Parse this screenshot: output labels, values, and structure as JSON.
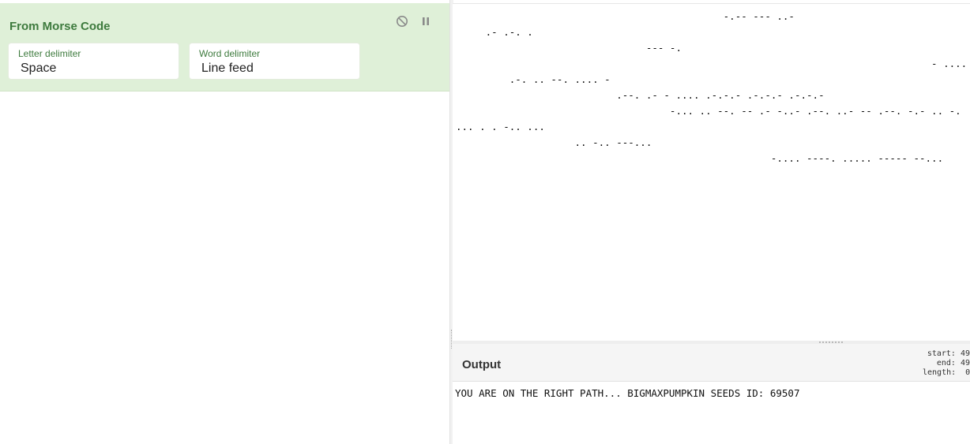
{
  "recipe": {
    "operation_title": "From Morse Code",
    "icons": {
      "disable": "disable-icon",
      "pause": "pause-icon"
    },
    "letter_delimiter": {
      "label": "Letter delimiter",
      "value": "Space"
    },
    "word_delimiter": {
      "label": "Word delimiter",
      "value": "Line feed"
    }
  },
  "input": {
    "text": "                                             -.-- --- ..-\n     .- .-. .\n                                --- -.\n                                                                                - .... .\n         .-. .. --. .... -\n                           .--. .- - .... .-.-.- .-.-.- .-.-.-\n                                    -... .. --. -- .- -..- .--. ..- -- .--. -.- .. -.\n... . . -.. ...\n                    .. -.. ---...\n                                                     -.... ----. ..... ----- --..."
  },
  "output": {
    "title": "Output",
    "info": "start: 49\n  end: 49\nlength:  0",
    "text": "YOU ARE ON THE RIGHT PATH... BIGMAXPUMPKIN SEEDS ID: 69507"
  },
  "colors": {
    "operation_bg": "#dff0d8",
    "operation_title": "#3d7a3d",
    "field_label": "#3d7a3d"
  }
}
